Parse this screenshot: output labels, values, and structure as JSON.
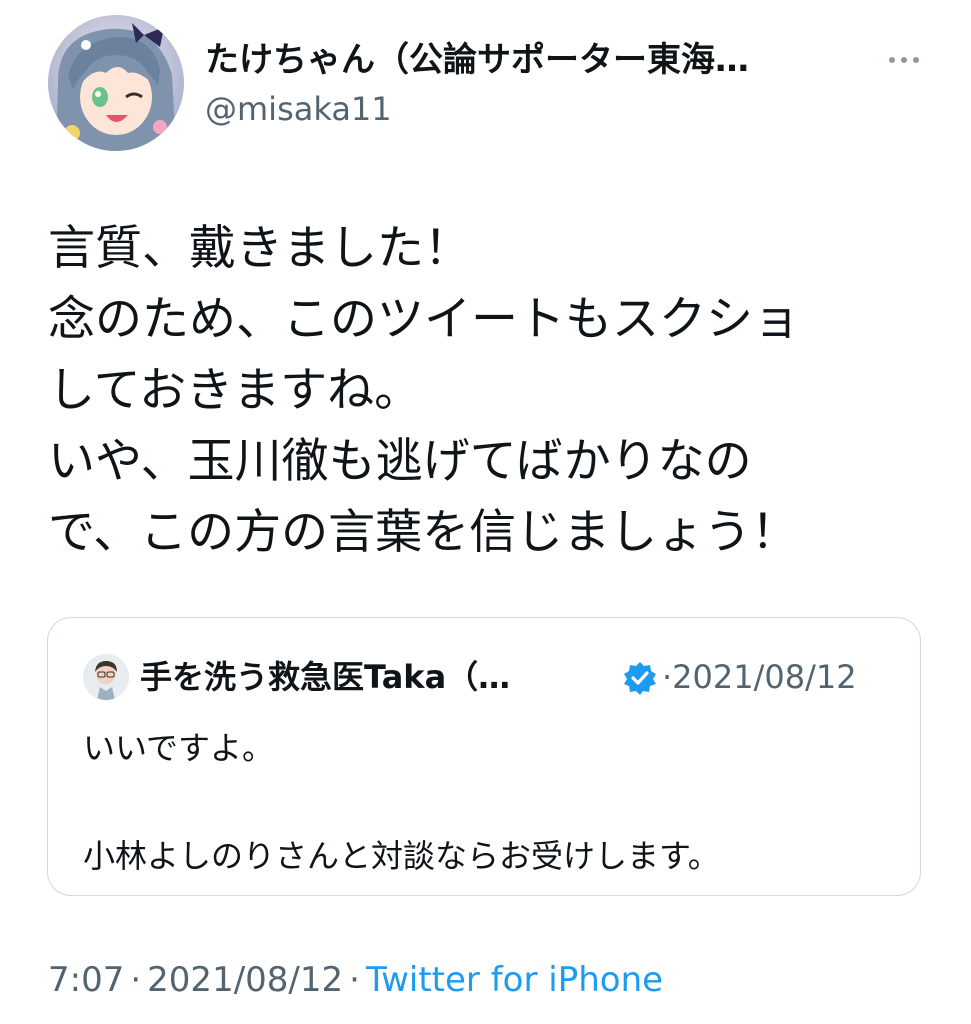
{
  "author": {
    "display_name": "たけちゃん（公論サポーター東海…",
    "handle": "@misaka11",
    "avatar_icon": "anime-avatar-icon"
  },
  "more_icon": "more-horizontal-icon",
  "tweet": {
    "text": "言質、戴きました！\n念のため、このツイートもスクショ\nしておきますね。\nいや、玉川徹も逃げてばかりなの\nで、この方の言葉を信じましょう！"
  },
  "quoted_tweet": {
    "display_name": "手を洗う救急医Taka（…",
    "verified_icon": "verified-badge-icon",
    "date": "·2021/08/12",
    "text": "いいですよ。\n\n小林よしのりさんと対談ならお受けします。"
  },
  "footer": {
    "time": "7:07",
    "separator": "·",
    "date": "2021/08/12",
    "source": "Twitter for iPhone"
  },
  "colors": {
    "text": "#0f1419",
    "secondary": "#536471",
    "link": "#1d9bf0",
    "border": "#cfd9de"
  }
}
